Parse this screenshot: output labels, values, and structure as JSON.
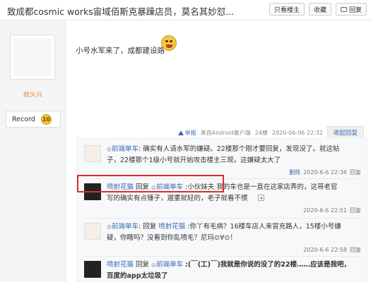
{
  "header": {
    "title": "致成都cosmic works宙域佰斯克暴躁店员，莫名其妙怼...",
    "actions": {
      "only_op": "只看楼主",
      "favorite": "收藏",
      "reply": "回复"
    }
  },
  "sidebar": {
    "username": "蚊头兴",
    "record_label": "Record",
    "record_level": "10"
  },
  "post": {
    "text": "小号水军来了，成都建设路",
    "meta": {
      "report": "举报",
      "source": "来自Android客户端",
      "floor": "24楼",
      "time": "2020-06-06 22:32",
      "collapse": "收起回复"
    }
  },
  "replies": [
    {
      "name": "前端单车",
      "text1": "确实有人请水军的嫌疑。22楼那个刚才要回复，发现没了。就这帖",
      "text2": "子，22楼那个1级小号就开始攻击楼主三观，这嫌疑太大了",
      "delete": "删除",
      "time": "2020-6-6 22:36",
      "reply": "回复"
    },
    {
      "name": "喷射花猫",
      "reply_word": "回复",
      "target": "前端单车",
      "quote": ":小伙妹夫",
      "text1": "我的车也是一直在这家店弄的，这哥老官",
      "text2": "写的确实有点锤子，遛重就轻的，老子就看不惯",
      "time": "2020-6-6 22:51",
      "reply": "回复"
    },
    {
      "name": "前端单车",
      "reply_word": "回复",
      "target": "喷射花猫",
      "text1": ":你丫有毛病？16楼车店人来冒充路人，15楼小号嫌",
      "text2": "疑，你瞎吗？没看到你乱喷毛？尼玛⊙∀⊙！",
      "time": "2020-6-6 22:58",
      "reply": "回复"
    },
    {
      "name": "喷射花猫",
      "reply_word": "回复",
      "target": "前端单车",
      "text1": ":(￣(工)￣)我就是你说的没了的22楼……应该是我吧，",
      "text2": "百度的app太垃圾了"
    }
  ]
}
